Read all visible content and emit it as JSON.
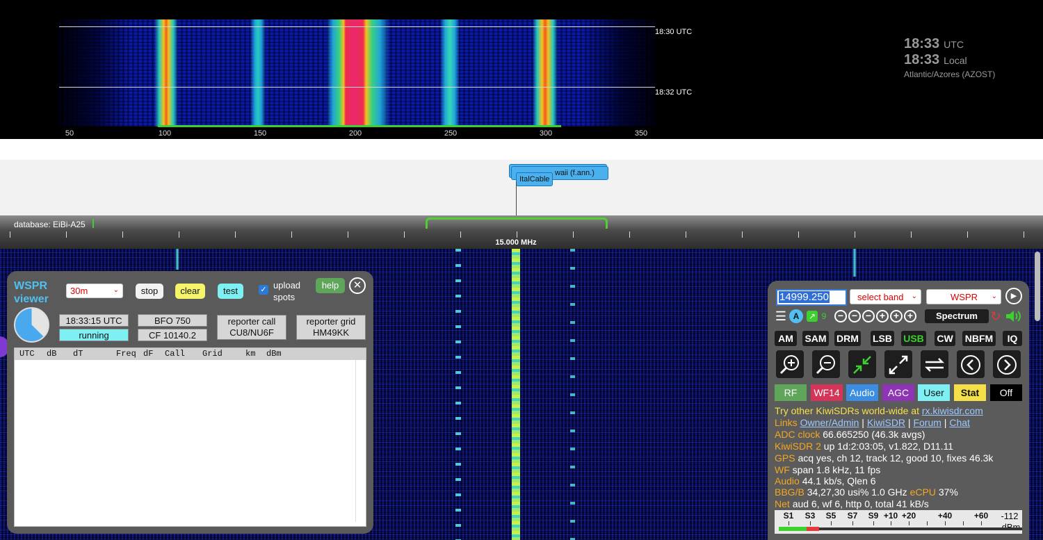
{
  "top_waterfall": {
    "time_markers": [
      "18:30 UTC",
      "18:32 UTC"
    ],
    "freq_ticks": [
      "50",
      "100",
      "150",
      "200",
      "250",
      "300",
      "350"
    ]
  },
  "clock": {
    "utc_time": "18:33",
    "utc_label": "UTC",
    "local_time": "18:33",
    "local_label": "Local",
    "timezone": "Atlantic/Azores (AZOST)"
  },
  "stations": {
    "back_label": "waii (f.ann.)",
    "front_label": "ItalCable"
  },
  "scale": {
    "database": "database: EiBi-A25",
    "center_freq": "15.000 MHz"
  },
  "wspr": {
    "title": "WSPR viewer",
    "band": "30m",
    "stop_label": "stop",
    "clear_label": "clear",
    "test_label": "test",
    "upload_label": "upload spots",
    "upload_checked": true,
    "help_label": "help",
    "utc_time": "18:33:15 UTC",
    "status": "running",
    "bfo": "BFO 750",
    "cf": "CF 10140.2",
    "reporter_call_label": "reporter call",
    "reporter_call": "CU8/NU6F",
    "reporter_grid_label": "reporter grid",
    "reporter_grid": "HM49KK",
    "progress": 0.625,
    "columns": [
      "UTC",
      "dB",
      "dT",
      "Freq",
      "dF",
      "Call",
      "Grid",
      "km",
      "dBm"
    ]
  },
  "control": {
    "frequency": "14999.250",
    "band_select": "select band",
    "ext_select": "WSPR",
    "zoom_level": "9",
    "spectrum_label": "Spectrum",
    "modes": [
      "AM",
      "SAM",
      "DRM",
      "LSB",
      "USB",
      "CW",
      "NBFM",
      "IQ"
    ],
    "active_mode": "USB",
    "tabs": {
      "rf": "RF",
      "wf": "WF14",
      "audio": "Audio",
      "agc": "AGC",
      "user": "User",
      "stat": "Stat",
      "off": "Off"
    },
    "status": {
      "try_other": "Try other KiwiSDRs world-wide at",
      "try_link": "rx.kiwisdr.com",
      "links_key": "Links",
      "link_owner": "Owner/Admin",
      "link_kiwi": "KiwiSDR",
      "link_forum": "Forum",
      "link_chat": "Chat",
      "adc_key": "ADC clock",
      "adc_val": "66.665250 (46.3k avgs)",
      "kiwi_key": "KiwiSDR 2",
      "kiwi_val": "up 1d:2:03:05, v1.822, D11.11",
      "gps_key": "GPS",
      "gps_val": "acq yes, ch 12, track 12, good 10, fixes 46.3k",
      "wf_key": "WF",
      "wf_val": "span 1.8 kHz, 11 fps",
      "audio_key": "Audio",
      "audio_val": "44.1 kb/s, Qlen 6",
      "bbg_key": "BBG/B",
      "bbg_val": "34,27,30 usi% 1.0 GHz",
      "ecpu_key": "eCPU",
      "ecpu_val": "37%",
      "net_key": "Net",
      "net_val": "aud 6, wf 6, http 0, total 41 kB/s"
    },
    "smeter": {
      "labels": [
        "S1",
        "S3",
        "S5",
        "S7",
        "S9",
        "+10",
        "+20",
        "+40",
        "+60"
      ],
      "value": "-112",
      "unit": "dBm"
    }
  },
  "colors": {
    "accent_blue": "#4fc0f0",
    "active_mode": "#3dd130",
    "passband": "#4fd130",
    "station_label": "#4ab0ee"
  }
}
